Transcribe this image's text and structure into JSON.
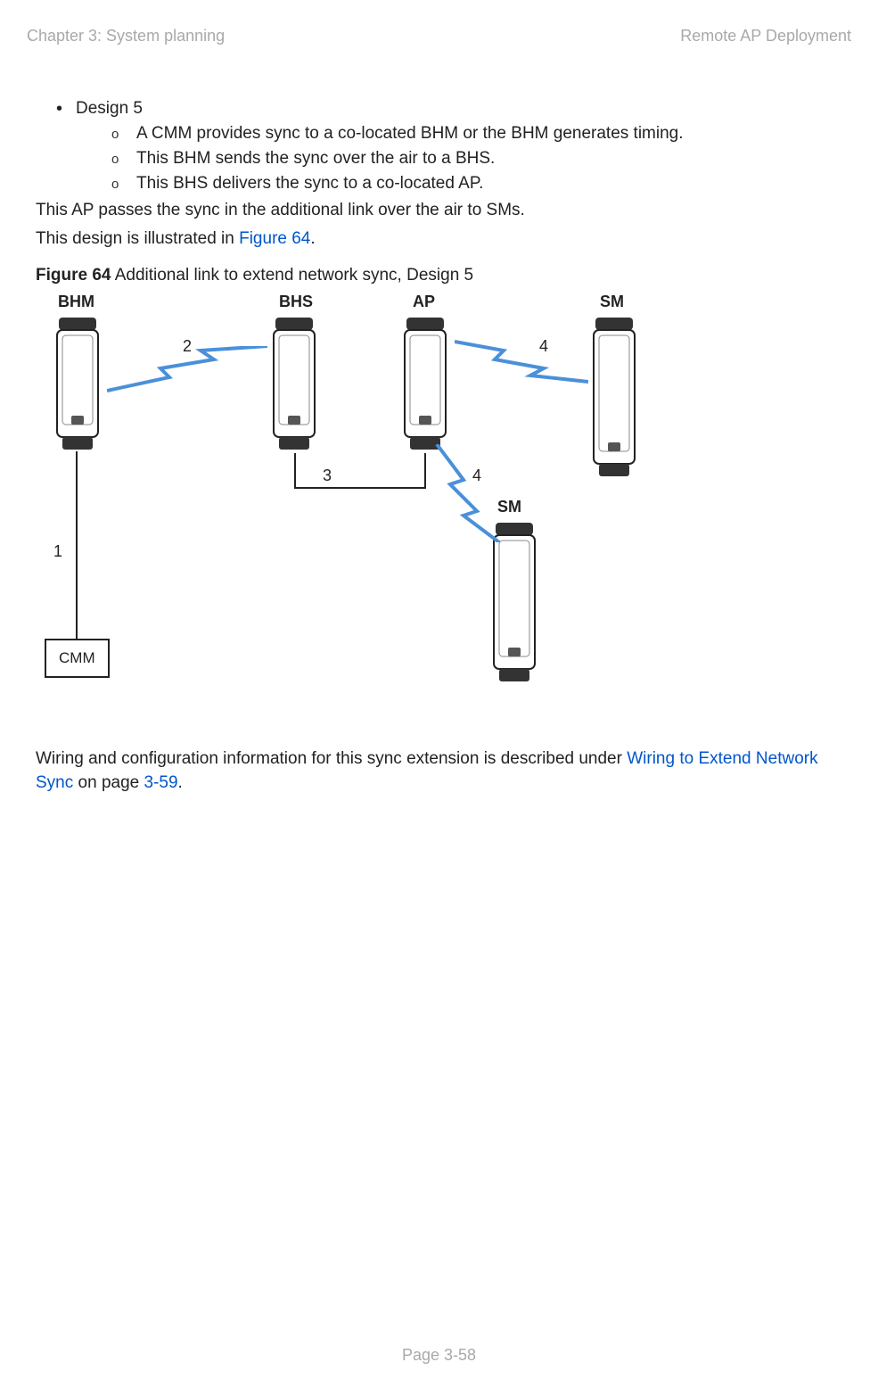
{
  "header": {
    "left": "Chapter 3:  System planning",
    "right": "Remote AP Deployment"
  },
  "content": {
    "design_title": "Design 5",
    "sub1": "A CMM provides sync to a co-located BHM or the BHM generates timing.",
    "sub2": "This BHM sends the sync over the air to a BHS.",
    "sub3": "This BHS delivers the sync to a co-located AP.",
    "para1": "This AP passes the sync in the additional link over the air to SMs.",
    "para2_pre": "This design is illustrated in ",
    "para2_link": "Figure 64",
    "para2_post": ".",
    "fig_label": "Figure 64",
    "fig_title": " Additional link to extend network sync, Design 5",
    "wiring_pre": "Wiring and configuration information for this sync extension is described under ",
    "wiring_link": "Wiring to Extend Network Sync",
    "wiring_mid": " on page ",
    "wiring_page": "3-59",
    "wiring_post": "."
  },
  "figure": {
    "labels": {
      "bhm": "BHM",
      "bhs": "BHS",
      "ap": "AP",
      "sm": "SM",
      "cmm": "CMM"
    },
    "nums": {
      "n1": "1",
      "n2": "2",
      "n3": "3",
      "n4a": "4",
      "n4b": "4"
    }
  },
  "footer": {
    "page": "Page 3-58"
  }
}
